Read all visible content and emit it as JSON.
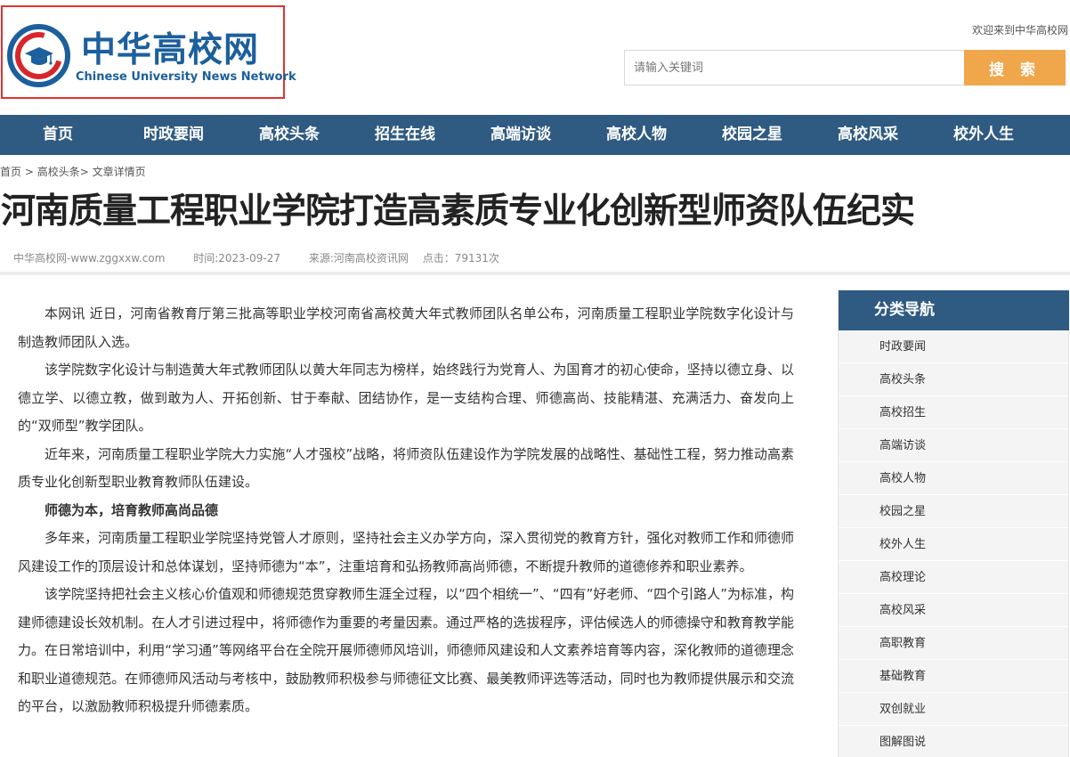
{
  "logo": {
    "cn_blue": "中华",
    "cn_rest": "高校网",
    "en": "Chinese University News Network"
  },
  "header": {
    "welcome": "欢迎来到中华高校网",
    "search_placeholder": "请输入关键词",
    "search_button": "搜 索"
  },
  "nav": {
    "items": [
      "首页",
      "时政要闻",
      "高校头条",
      "招生在线",
      "高端访谈",
      "高校人物",
      "校园之星",
      "高校风采",
      "校外人生"
    ]
  },
  "breadcrumb": {
    "home": "首页",
    "sep1": " > ",
    "section": "高校头条",
    "sep2": "> ",
    "current": "文章详情页"
  },
  "article": {
    "title": "河南质量工程职业学院打造高素质专业化创新型师资队伍纪实",
    "meta": {
      "site": "中华高校网-www.zggxxw.com",
      "time": "时间:2023-09-27",
      "source": "来源:河南高校资讯网",
      "clicks": "点击：79131次"
    },
    "paragraphs": [
      "本网讯 近日，河南省教育厅第三批高等职业学校河南省高校黄大年式教师团队名单公布，河南质量工程职业学院数字化设计与制造教师团队入选。",
      "该学院数字化设计与制造黄大年式教师团队以黄大年同志为榜样，始终践行为党育人、为国育才的初心使命，坚持以德立身、以德立学、以德立教，做到敢为人、开拓创新、甘于奉献、团结协作，是一支结构合理、师德高尚、技能精湛、充满活力、奋发向上的“双师型”教学团队。",
      "近年来，河南质量工程职业学院大力实施“人才强校”战略，将师资队伍建设作为学院发展的战略性、基础性工程，努力推动高素质专业化创新型职业教育教师队伍建设。",
      "师德为本，培育教师高尚品德",
      "多年来，河南质量工程职业学院坚持党管人才原则，坚持社会主义办学方向，深入贯彻党的教育方针，强化对教师工作和师德师风建设工作的顶层设计和总体谋划，坚持师德为“本”，注重培育和弘扬教师高尚师德，不断提升教师的道德修养和职业素养。",
      "该学院坚持把社会主义核心价值观和师德规范贯穿教师生涯全过程，以“四个相统一”、“四有”好老师、“四个引路人”为标准，构建师德建设长效机制。在人才引进过程中，将师德作为重要的考量因素。通过严格的选拔程序，评估候选人的师德操守和教育教学能力。在日常培训中，利用“学习通”等网络平台在全院开展师德师风培训，师德师风建设和人文素养培育等内容，深化教师的道德理念和职业道德规范。在师德师风活动与考核中，鼓励教师积极参与师德征文比赛、最美教师评选等活动，同时也为教师提供展示和交流的平台，以激励教师积极提升师德素质。"
    ]
  },
  "sidebar": {
    "title": "分类导航",
    "items": [
      "时政要闻",
      "高校头条",
      "高校招生",
      "高端访谈",
      "高校人物",
      "校园之星",
      "校外人生",
      "高校理论",
      "高校风采",
      "高职教育",
      "基础教育",
      "双创就业",
      "图解图说"
    ]
  },
  "colors": {
    "nav_bg": "#2f5b82",
    "search_button": "#f0a64a",
    "logo_blue": "#1c5f9c",
    "logo_red": "#d7262b",
    "highlight_border": "#e23333"
  }
}
